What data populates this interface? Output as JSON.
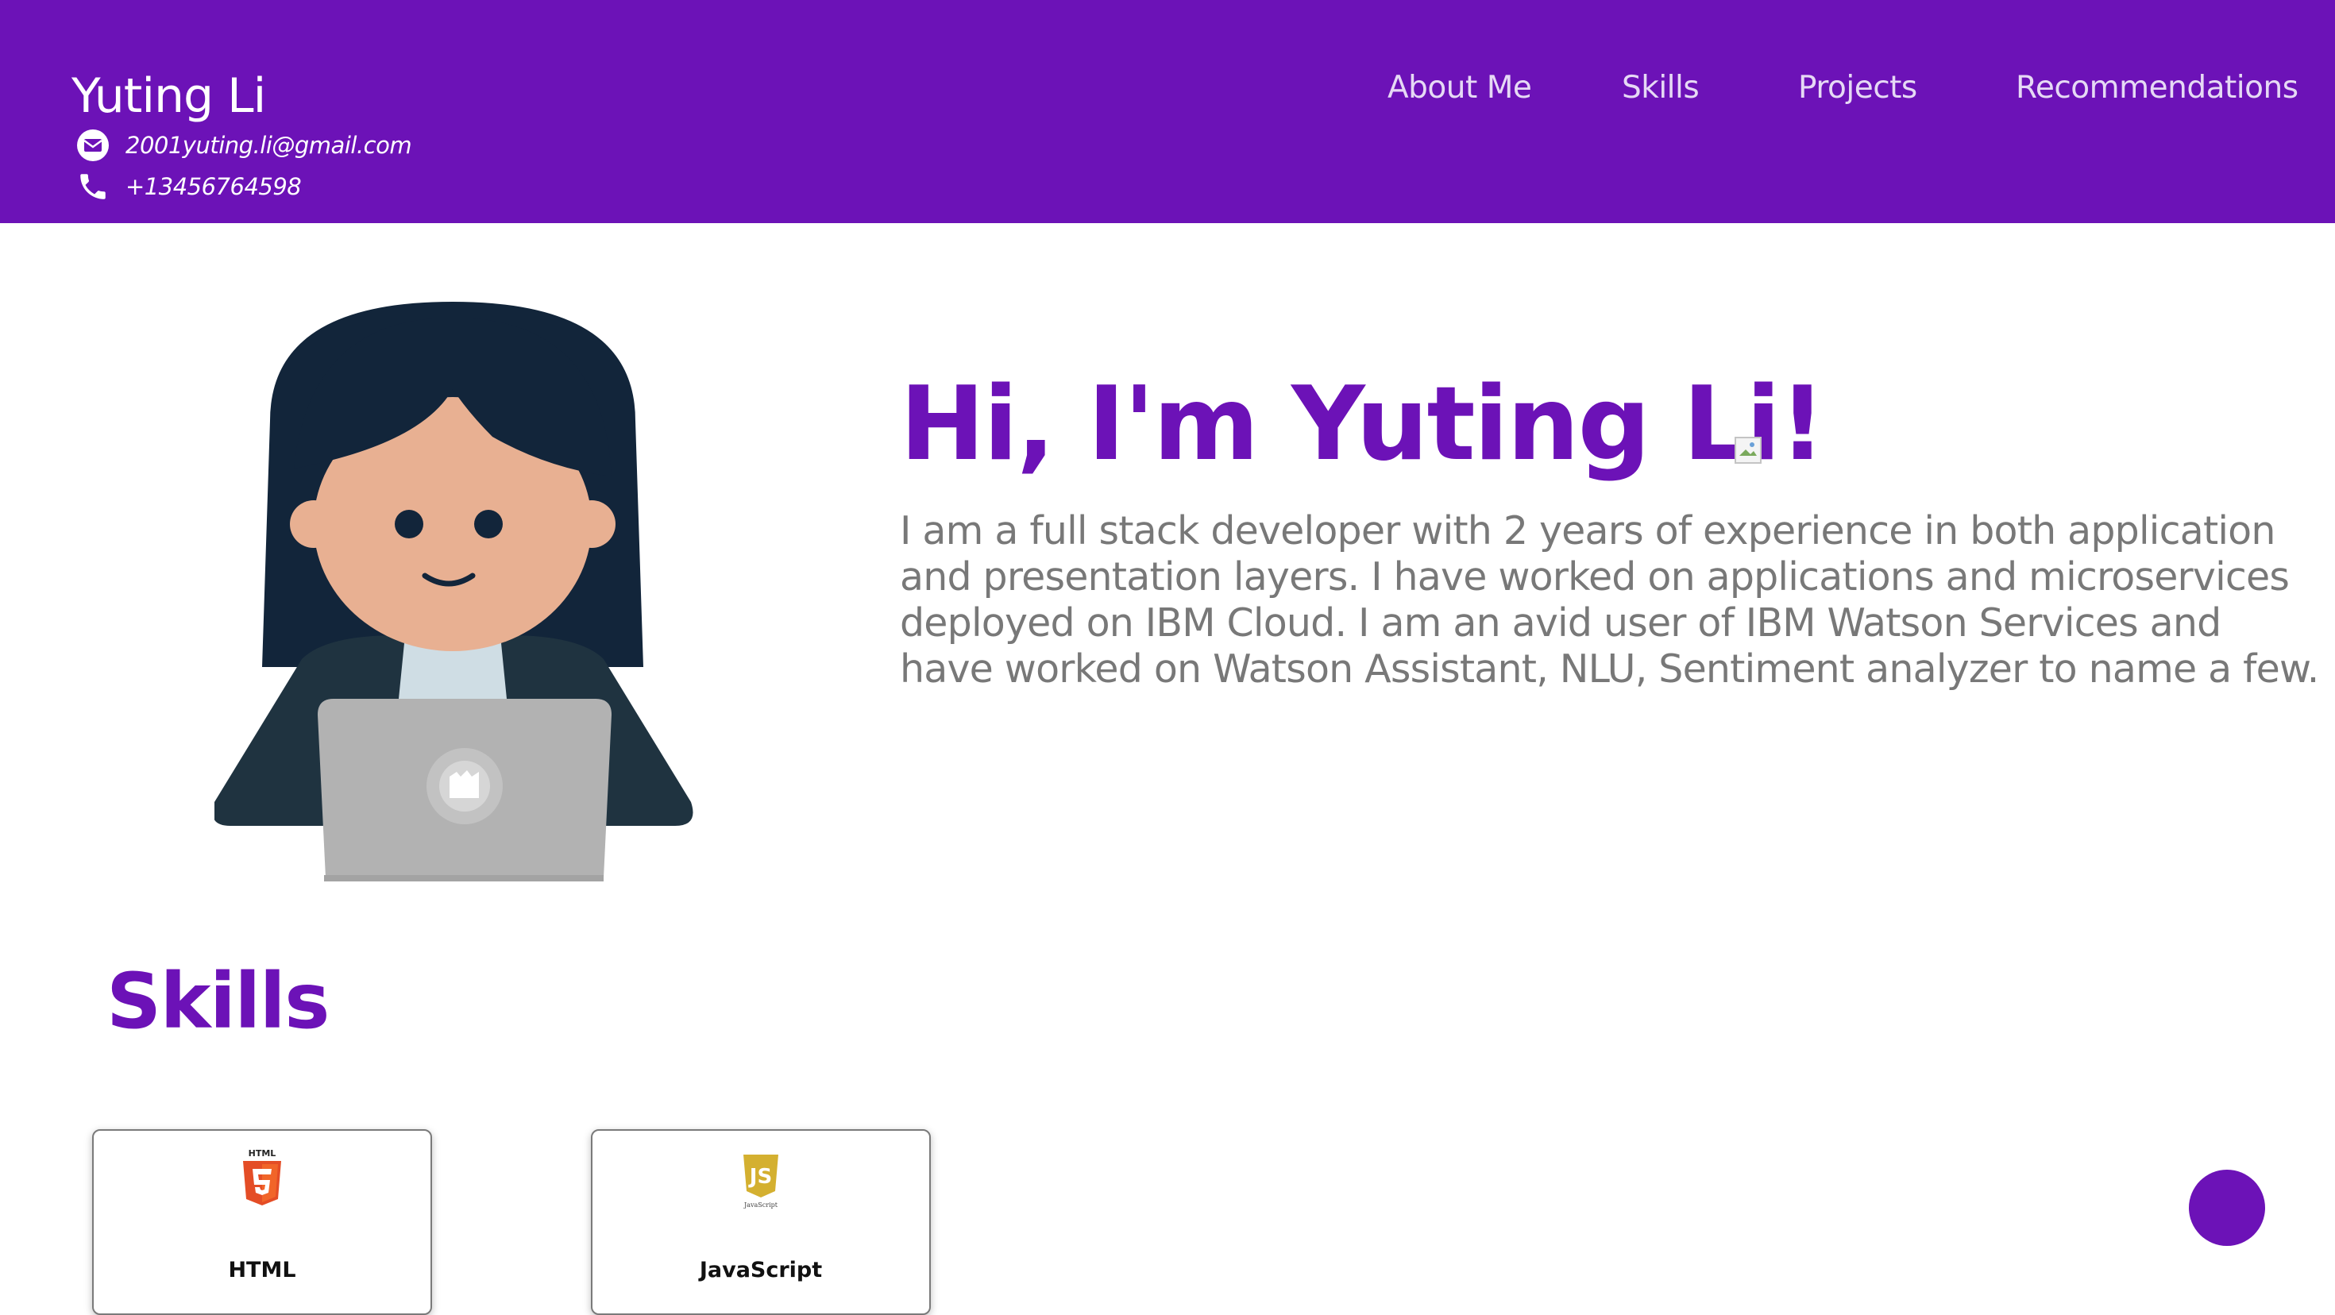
{
  "header": {
    "name": "Yuting Li",
    "email": "2001yuting.li@gmail.com",
    "phone": "+13456764598",
    "email_icon": "mail-icon",
    "phone_icon": "phone-icon",
    "nav": [
      {
        "label": "About Me"
      },
      {
        "label": "Skills"
      },
      {
        "label": "Projects"
      },
      {
        "label": "Recommendations"
      }
    ]
  },
  "hero": {
    "title": "Hi, I'm Yuting Li!",
    "description": "I am a full stack developer with 2 years of experience in both application and presentation layers. I have worked on applications and microservices deployed on IBM Cloud. I am an avid user of IBM Watson Services and have worked on Watson Assistant, NLU, Sentiment analyzer to name a few."
  },
  "skills": {
    "heading": "Skills",
    "items": [
      {
        "label": "HTML",
        "icon": "html5-logo-icon"
      },
      {
        "label": "JavaScript",
        "icon": "javascript-logo-icon"
      }
    ]
  },
  "colors": {
    "brand": "#6c12b7",
    "text_gray": "#787878"
  }
}
